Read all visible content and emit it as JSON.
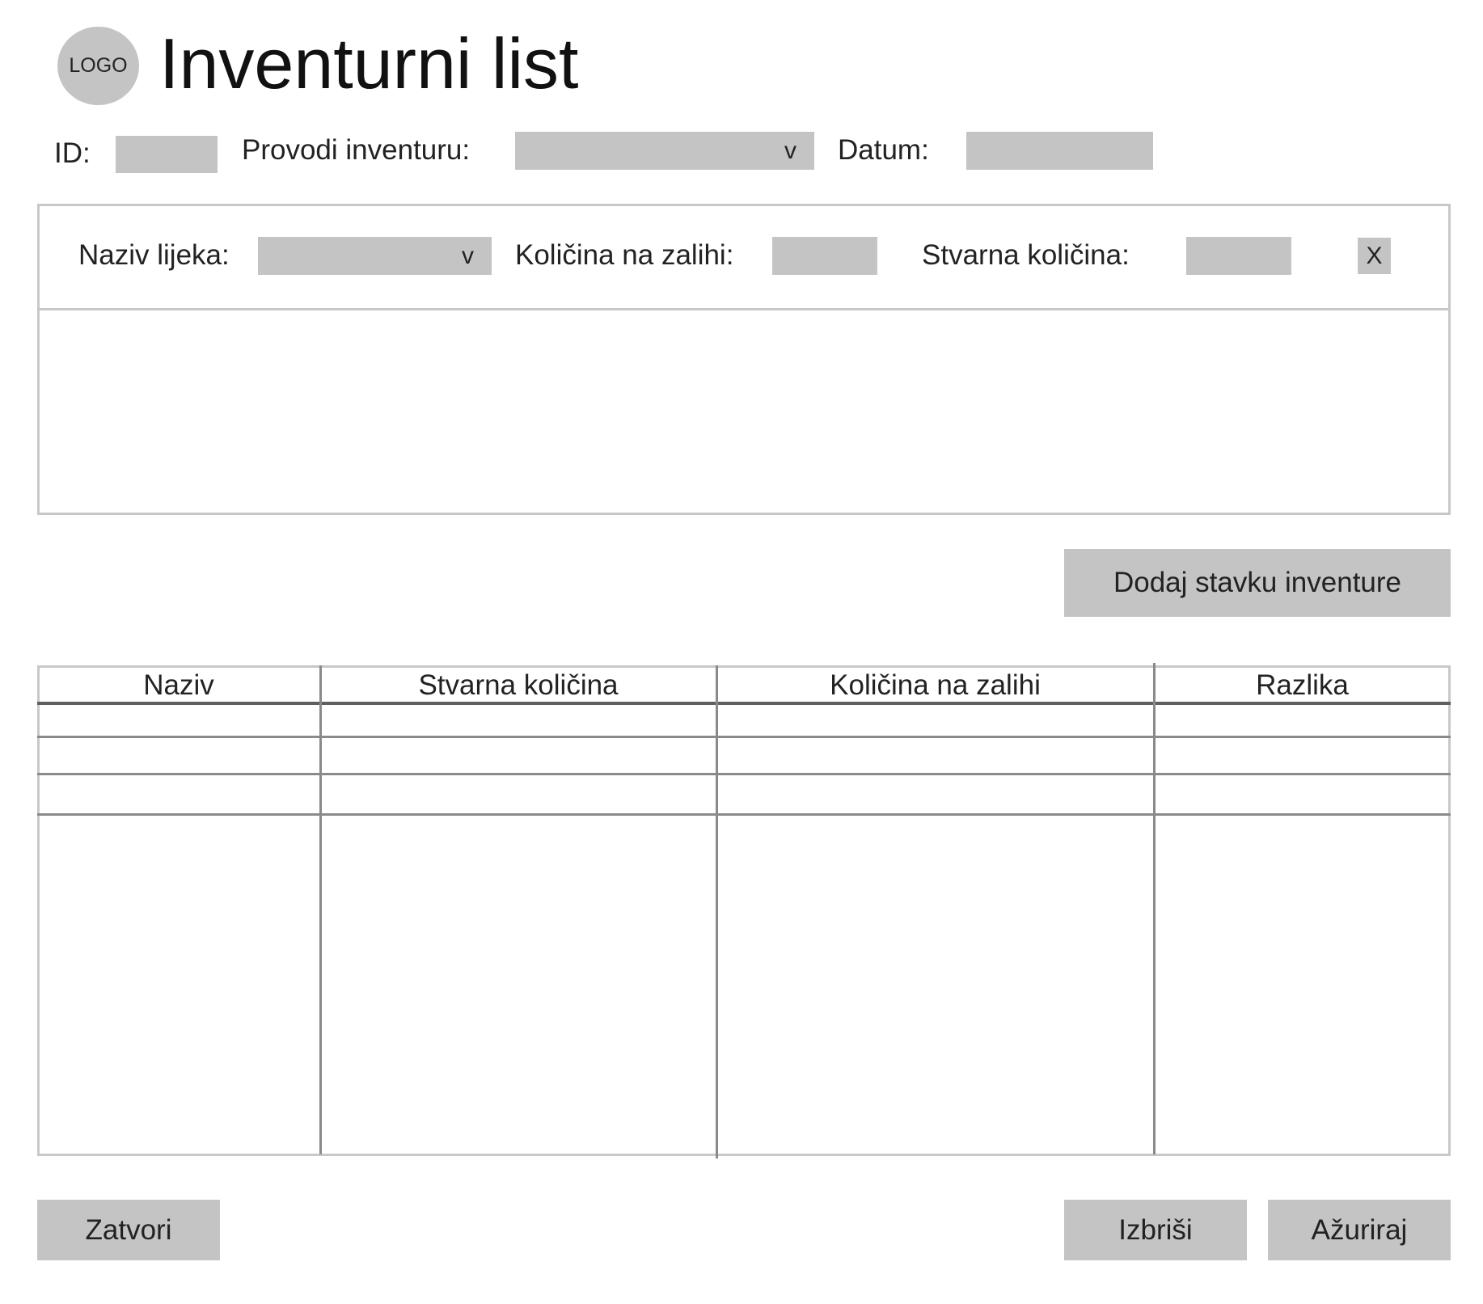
{
  "header": {
    "logo_text": "LOGO",
    "title": "Inventurni list"
  },
  "meta": {
    "id_label": "ID:",
    "id_value": "",
    "provodi_label": "Provodi inventuru:",
    "provodi_value": "",
    "provodi_arrow": "v",
    "datum_label": "Datum:",
    "datum_value": ""
  },
  "item_form": {
    "naziv_label": "Naziv lijeka:",
    "naziv_value": "",
    "naziv_arrow": "v",
    "zaliha_label": "Količina na zalihi:",
    "zaliha_value": "",
    "stvarna_label": "Stvarna količina:",
    "stvarna_value": "",
    "remove_label": "X"
  },
  "add_button_label": "Dodaj stavku inventure",
  "table": {
    "columns": [
      "Naziv",
      "Stvarna količina",
      "Količina na zalihi",
      "Razlika"
    ],
    "rows": []
  },
  "footer": {
    "close_label": "Zatvori",
    "delete_label": "Izbriši",
    "update_label": "Ažuriraj"
  }
}
